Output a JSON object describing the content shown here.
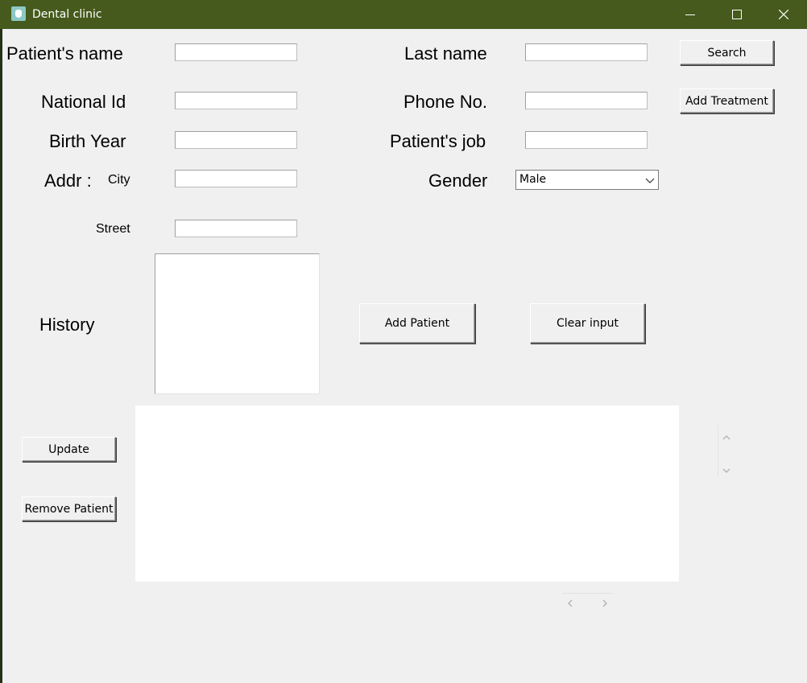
{
  "window": {
    "title": "Dental clinic",
    "icons": {
      "app": "tooth-app-icon",
      "minimize": "minimize-icon",
      "maximize": "maximize-icon",
      "close": "close-icon"
    },
    "colors": {
      "titlebar": "#455a1c",
      "background": "#f0f0f0"
    }
  },
  "form": {
    "patient_name_label": "Patient's name",
    "last_name_label": "Last name",
    "national_id_label": "National Id",
    "phone_label": "Phone No.",
    "birth_year_label": "Birth Year",
    "job_label": "Patient's job",
    "addr_label": "Addr :",
    "city_label": "City",
    "gender_label": "Gender",
    "street_label": "Street",
    "history_label": "History",
    "gender_value": "Male",
    "patient_name_value": "",
    "last_name_value": "",
    "national_id_value": "",
    "phone_value": "",
    "birth_year_value": "",
    "job_value": "",
    "city_value": "",
    "street_value": ""
  },
  "buttons": {
    "search": "Search",
    "add_treatment": "Add Treatment",
    "add_patient": "Add Patient",
    "clear_input": "Clear input",
    "update": "Update",
    "remove_patient": "Remove Patient"
  }
}
